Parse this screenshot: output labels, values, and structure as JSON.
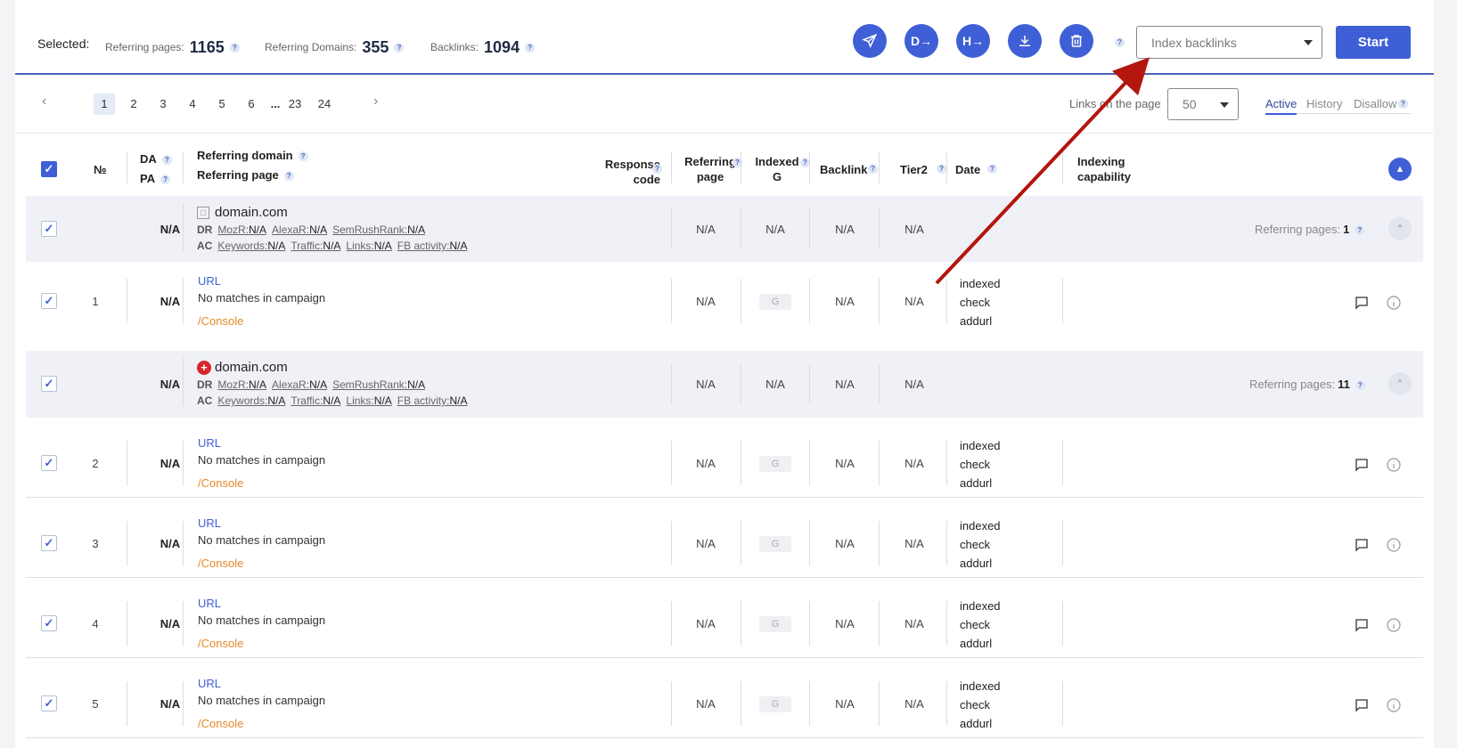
{
  "toolbar": {
    "selected_label": "Selected:",
    "referring_pages_label": "Referring pages:",
    "referring_pages_value": "1165",
    "referring_domains_label": "Referring Domains:",
    "referring_domains_value": "355",
    "backlinks_label": "Backlinks:",
    "backlinks_value": "1094",
    "action_select_placeholder": "Index backlinks",
    "start_label": "Start",
    "action_icons": [
      "send-icon",
      "domain-export-icon",
      "host-export-icon",
      "download-icon",
      "trash-icon"
    ]
  },
  "pager": {
    "pages": [
      "1",
      "2",
      "3",
      "4",
      "5",
      "6"
    ],
    "ellipsis": "...",
    "last_pages": [
      "23",
      "24"
    ],
    "active_page": "1",
    "links_on_page_label": "Links on the page",
    "links_on_page_value": "50",
    "tabs": [
      "Active",
      "History",
      "Disallow"
    ],
    "active_tab": "Active"
  },
  "table": {
    "headers": {
      "number": "№",
      "da": "DA",
      "pa": "PA",
      "referring_domain": "Referring domain",
      "referring_page": "Referring page",
      "response_code_1": "Response",
      "response_code_2": "code",
      "ref_page_1": "Referring",
      "ref_page_2": "page",
      "indexed_1": "Indexed",
      "indexed_2": "G",
      "backlink": "Backlink",
      "tier2": "Tier2",
      "date": "Date",
      "indexing_1": "Indexing",
      "indexing_2": "capability"
    },
    "groups": [
      {
        "domain": "domain.com",
        "da": "N/A",
        "dr_label": "DR",
        "ac_label": "AC",
        "mozr": "N/A",
        "alexar": "N/A",
        "semrush": "N/A",
        "keywords": "N/A",
        "traffic": "N/A",
        "links": "N/A",
        "fb": "N/A",
        "ref_page": "N/A",
        "indexed": "N/A",
        "backlink": "N/A",
        "tier2": "N/A",
        "referring_pages_label": "Referring pages:",
        "referring_pages_count": "1"
      },
      {
        "domain": "domain.com",
        "da": "N/A",
        "dr_label": "DR",
        "ac_label": "AC",
        "mozr": "N/A",
        "alexar": "N/A",
        "semrush": "N/A",
        "keywords": "N/A",
        "traffic": "N/A",
        "links": "N/A",
        "fb": "N/A",
        "ref_page": "N/A",
        "indexed": "N/A",
        "backlink": "N/A",
        "tier2": "N/A",
        "referring_pages_label": "Referring pages:",
        "referring_pages_count": "11"
      }
    ],
    "metric_labels": {
      "mozr": "MozR:",
      "alexar": "AlexaR:",
      "semrush": "SemRushRank:",
      "keywords": "Keywords:",
      "traffic": "Traffic:",
      "links": "Links:",
      "fb": "FB activity:"
    },
    "rows": [
      {
        "num": "1",
        "pa": "N/A",
        "url": "URL",
        "nomatch": "No matches in campaign",
        "console": "/Console",
        "ref_page": "N/A",
        "indexed": "G",
        "backlink": "N/A",
        "tier2": "N/A",
        "idx1": "indexed",
        "idx2": "check",
        "idx3": "addurl"
      },
      {
        "num": "2",
        "pa": "N/A",
        "url": "URL",
        "nomatch": "No matches in campaign",
        "console": "/Console",
        "ref_page": "N/A",
        "indexed": "G",
        "backlink": "N/A",
        "tier2": "N/A",
        "idx1": "indexed",
        "idx2": "check",
        "idx3": "addurl"
      },
      {
        "num": "3",
        "pa": "N/A",
        "url": "URL",
        "nomatch": "No matches in campaign",
        "console": "/Console",
        "ref_page": "N/A",
        "indexed": "G",
        "backlink": "N/A",
        "tier2": "N/A",
        "idx1": "indexed",
        "idx2": "check",
        "idx3": "addurl"
      },
      {
        "num": "4",
        "pa": "N/A",
        "url": "URL",
        "nomatch": "No matches in campaign",
        "console": "/Console",
        "ref_page": "N/A",
        "indexed": "G",
        "backlink": "N/A",
        "tier2": "N/A",
        "idx1": "indexed",
        "idx2": "check",
        "idx3": "addurl"
      },
      {
        "num": "5",
        "pa": "N/A",
        "url": "URL",
        "nomatch": "No matches in campaign",
        "console": "/Console",
        "ref_page": "N/A",
        "indexed": "G",
        "backlink": "N/A",
        "tier2": "N/A",
        "idx1": "indexed",
        "idx2": "check",
        "idx3": "addurl"
      }
    ]
  },
  "colors": {
    "accent": "#3e5fd6",
    "annotation_arrow": "#b3160d",
    "console": "#e6892a"
  }
}
